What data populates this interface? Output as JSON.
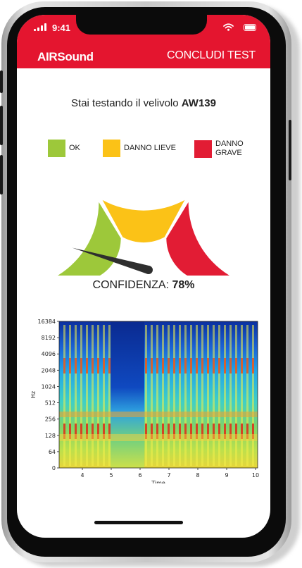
{
  "status_bar": {
    "time": "9:41"
  },
  "header": {
    "app_title": "AIRSound",
    "conclude_label": "CONCLUDI TEST"
  },
  "test": {
    "prefix": "Stai testando il velivolo",
    "aircraft": "AW139"
  },
  "legend": [
    {
      "label": "OK",
      "color": "#9dc83a"
    },
    {
      "label": "DANNO LIEVE",
      "color": "#fbc217"
    },
    {
      "label": "DANNO GRAVE",
      "color": "#e21c34"
    }
  ],
  "gauge": {
    "needle_fraction": 0.09
  },
  "confidence": {
    "label": "CONFIDENZA:",
    "value": "78%"
  },
  "spectrogram": {
    "y_ticks": [
      "16384",
      "8192",
      "4096",
      "2048",
      "1024",
      "512",
      "256",
      "128",
      "64",
      "0"
    ],
    "x_ticks": [
      "4",
      "5",
      "6",
      "7",
      "8",
      "9",
      "10"
    ],
    "y_label": "Hz",
    "x_label": "Time"
  },
  "icons": [
    "signal-icon",
    "wifi-icon",
    "battery-icon"
  ]
}
